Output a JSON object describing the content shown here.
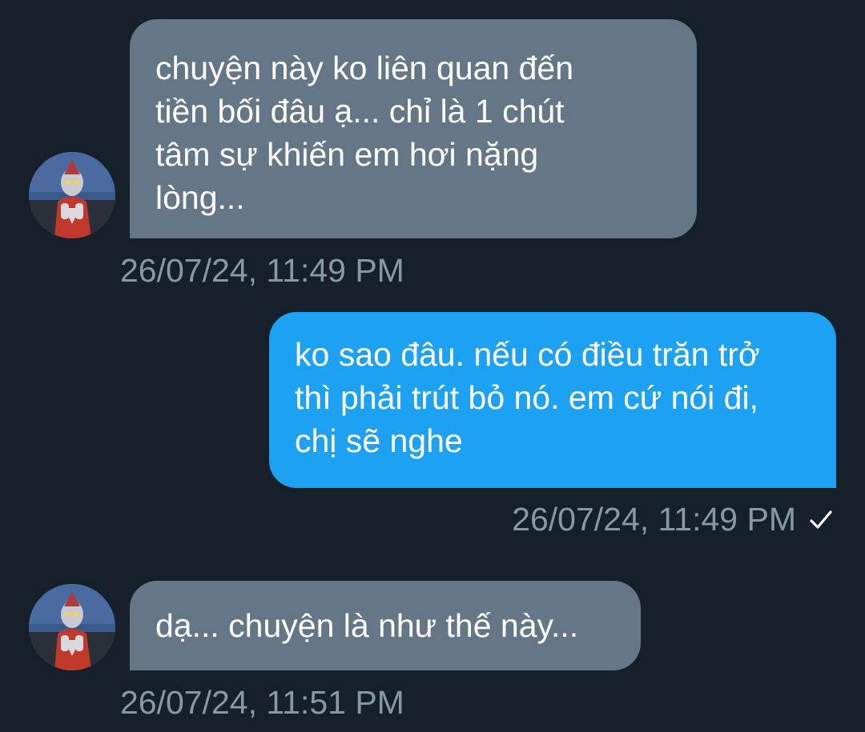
{
  "messages": [
    {
      "direction": "incoming",
      "text": "chuyện này ko liên quan đến\ntiền bối đâu ạ... chỉ là 1 chút\ntâm sự khiến em hơi nặng\nlòng...",
      "timestamp": "26/07/24, 11:49 PM"
    },
    {
      "direction": "outgoing",
      "text": "ko sao đâu. nếu có điều trăn trở\nthì phải trút bỏ nó. em cứ nói đi,\nchị sẽ nghe",
      "timestamp": "26/07/24, 11:49 PM",
      "status_icon": "checkmark-icon"
    },
    {
      "direction": "incoming",
      "text": "dạ... chuyện là như thế này...",
      "timestamp": "26/07/24, 11:51 PM"
    }
  ],
  "colors": {
    "background": "#15202b",
    "incoming_bubble": "#657786",
    "outgoing_bubble": "#1da1f2",
    "timestamp_text": "#8899a6"
  },
  "icons": {
    "avatar": "avatar-image"
  }
}
